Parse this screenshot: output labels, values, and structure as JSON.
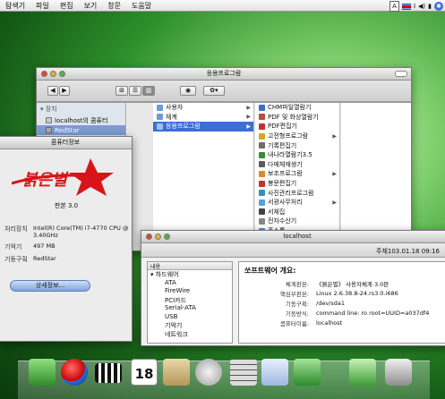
{
  "menubar": {
    "items": [
      "탐색기",
      "파일",
      "편집",
      "보기",
      "창문",
      "도움말"
    ],
    "input_indicator": "A",
    "status_text": "I"
  },
  "finder": {
    "title": "응용프로그람",
    "sidebar": {
      "header": "장치",
      "items": [
        {
          "label": "localhost의 콤퓨터"
        },
        {
          "label": "RedStar"
        }
      ]
    },
    "col1": [
      "사용자",
      "체계",
      "응용프로그람"
    ],
    "col2": [
      {
        "label": "CHM파일열람기",
        "arrow": false
      },
      {
        "label": "PDF 및 화상열람기",
        "arrow": false
      },
      {
        "label": "PDF편집기",
        "arrow": false
      },
      {
        "label": "고전형프로그람",
        "arrow": true
      },
      {
        "label": "기록편집기",
        "arrow": false
      },
      {
        "label": "내나라열람기3.5",
        "arrow": false
      },
      {
        "label": "다매체재생기",
        "arrow": false
      },
      {
        "label": "보조프로그람",
        "arrow": true
      },
      {
        "label": "봉문편집기",
        "arrow": false
      },
      {
        "label": "사진관리프로그람",
        "arrow": false
      },
      {
        "label": "서광사무처리",
        "arrow": true
      },
      {
        "label": "서체집",
        "arrow": false
      },
      {
        "label": "전자수산기",
        "arrow": false
      },
      {
        "label": "주소록",
        "arrow": false
      }
    ]
  },
  "computer_info": {
    "title": "콤퓨터정보",
    "logo_text": "붉은별",
    "version": "판본 3.0",
    "rows": [
      {
        "label": "처리장치",
        "value": "Intel(R) Core(TM) i7-4770 CPU @ 3.40GHz"
      },
      {
        "label": "기억기",
        "value": "497 MB"
      },
      {
        "label": "기동구획",
        "value": "RedStar"
      }
    ],
    "more_button": "상세정보..."
  },
  "system_info": {
    "title": "localhost",
    "date": "주체103.01.18 09:16",
    "tree_header": "내용",
    "tree": [
      {
        "label": "▾ 하드웨어",
        "sel": false,
        "indent": 0
      },
      {
        "label": "ATA",
        "sel": false,
        "indent": 1
      },
      {
        "label": "FireWire",
        "sel": false,
        "indent": 1
      },
      {
        "label": "PCI카드",
        "sel": false,
        "indent": 1
      },
      {
        "label": "Serial-ATA",
        "sel": false,
        "indent": 1
      },
      {
        "label": "USB",
        "sel": false,
        "indent": 1
      },
      {
        "label": "기억기",
        "sel": false,
        "indent": 1
      },
      {
        "label": "네트워크",
        "sel": false,
        "indent": 1
      }
    ],
    "heading": "쏘프트웨어 개요:",
    "rows": [
      {
        "label": "체계판본:",
        "value": "《붉은별》 사용자체계 3.0판"
      },
      {
        "label": "핵심부판본:",
        "value": "Linux 2.6.38.8-24.rs3.0.i686"
      },
      {
        "label": "기동구획:",
        "value": "/dev/sda1"
      },
      {
        "label": "기동방식:",
        "value": "command line: ro root=UUID=a037df4"
      },
      {
        "label": "콤퓨터이름:",
        "value": "localhost"
      }
    ]
  },
  "dock": {
    "calendar_day": "18"
  },
  "colors": {
    "accent": "#3b6ed6",
    "red_logo": "#d8141a",
    "wallpaper": "#2d8f2a"
  }
}
